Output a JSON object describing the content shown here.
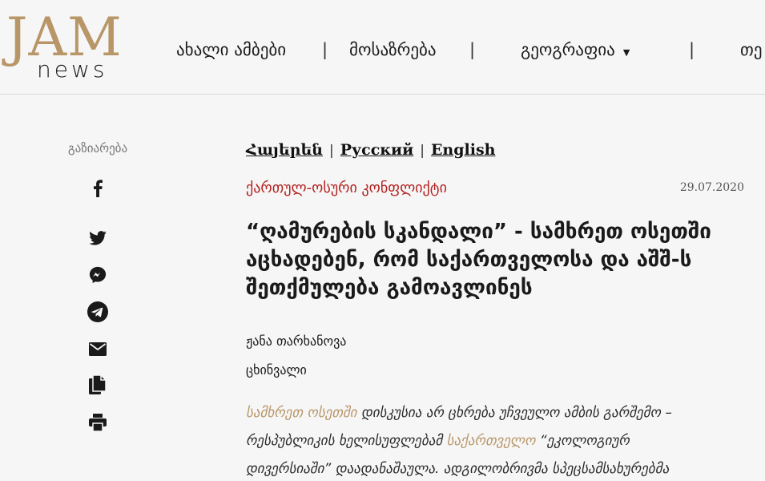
{
  "brand": {
    "logo_main": "JAM",
    "logo_sub": "news"
  },
  "nav": {
    "items": [
      "ახალი ამბები",
      "მოსაზრება",
      "გეოგრაფია",
      "თე"
    ],
    "separator": "|",
    "caret": "▼"
  },
  "share": {
    "label": "გაზიარება"
  },
  "article": {
    "languages": [
      "Հայերեն",
      "Русский",
      "English"
    ],
    "lang_separator": "|",
    "category": "ქართულ-ოსური კონფლიქტი",
    "date": "29.07.2020",
    "title": "“ღამურების სკანდალი” - სამხრეთ ოსეთში აცხადებენ, რომ საქართველოსა და აშშ-ს შეთქმულება გამოავლინეს",
    "author": "ჟანა თარხანოვა",
    "place": "ცხინვალი",
    "body": {
      "link1": "სამხრეთ ოსეთში",
      "text1": " დისკუსია არ ცხრება უჩვეულო ამბის გარშემო – რესპუბლიკის ხელისუფლებამ ",
      "link2": "საქართველო",
      "text2": " “ეკოლოგიურ დივერსიაში” დაადანაშაულა. ადგილობრივმა სპეცსამსახურებმა"
    }
  },
  "colors": {
    "accent_gold": "#b89668",
    "category_red": "#b3201e",
    "background": "#f6f6f6"
  }
}
